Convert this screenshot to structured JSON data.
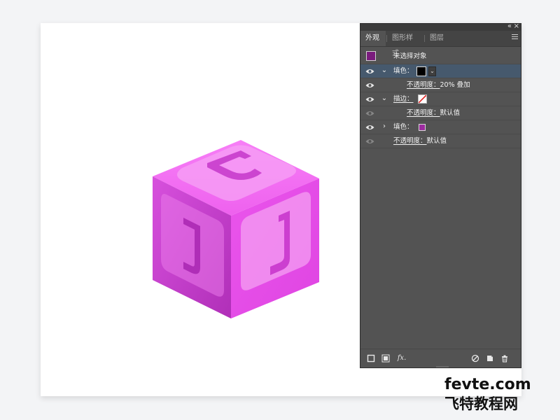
{
  "canvas": {
    "artwork": {
      "letter": "J",
      "colors": {
        "top": "#f06af0",
        "left": "#c13bc8",
        "right": "#e44ce6",
        "inner_panel": "#f4a1f2",
        "letter": "#c83ccc"
      }
    }
  },
  "panel": {
    "controls": {
      "collapse_icon": "«",
      "close_icon": "×"
    },
    "tabs": [
      {
        "label": "外观",
        "active": true
      },
      {
        "label": "图形样式",
        "active": false
      },
      {
        "label": "图层",
        "active": false
      }
    ],
    "object": {
      "label": "未选择对象",
      "swatch_color": "#7a1c7d"
    },
    "rows": [
      {
        "kind": "fill",
        "visible": true,
        "expanded": true,
        "label": "填色：",
        "swatch_color": "#000000",
        "selected": true
      },
      {
        "kind": "opacity",
        "visible": true,
        "label": "不透明度：",
        "value": "20% 叠加",
        "indent": true
      },
      {
        "kind": "stroke",
        "visible": true,
        "expanded": true,
        "label": "描边：",
        "swatch": "none-slash"
      },
      {
        "kind": "opacity",
        "visible": false,
        "label": "不透明度：",
        "value": "默认值",
        "indent": true
      },
      {
        "kind": "fill",
        "visible": true,
        "expanded": false,
        "label": "填色：",
        "swatch_color": "#9d2ca0"
      },
      {
        "kind": "opacity",
        "visible": false,
        "label": "不透明度：",
        "value": "默认值",
        "indent": false
      }
    ],
    "bottom_toolbar": [
      {
        "icon": "new-stroke-icon"
      },
      {
        "icon": "new-fill-icon"
      },
      {
        "icon": "fx-icon",
        "label": "fx."
      },
      {
        "icon": "clear-appearance-icon"
      },
      {
        "icon": "duplicate-item-icon"
      },
      {
        "icon": "trash-icon"
      }
    ]
  },
  "watermark": {
    "line1": "fevte.com",
    "line2": "飞特教程网"
  }
}
